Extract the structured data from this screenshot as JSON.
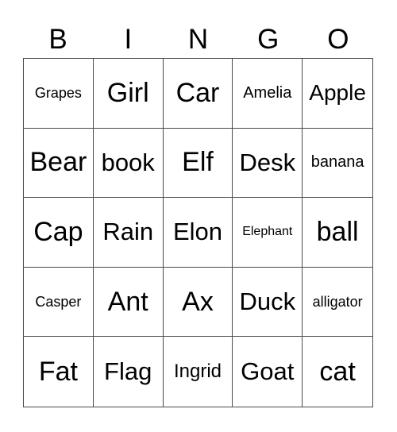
{
  "header": [
    "B",
    "I",
    "N",
    "G",
    "O"
  ],
  "cells": [
    [
      "Grapes",
      "Girl",
      "Car",
      "Amelia",
      "Apple"
    ],
    [
      "Bear",
      "book",
      "Elf",
      "Desk",
      "banana"
    ],
    [
      "Cap",
      "Rain",
      "Elon",
      "Elephant",
      "ball"
    ],
    [
      "Casper",
      "Ant",
      "Ax",
      "Duck",
      "alligator"
    ],
    [
      "Fat",
      "Flag",
      "Ingrid",
      "Goat",
      "cat"
    ]
  ]
}
